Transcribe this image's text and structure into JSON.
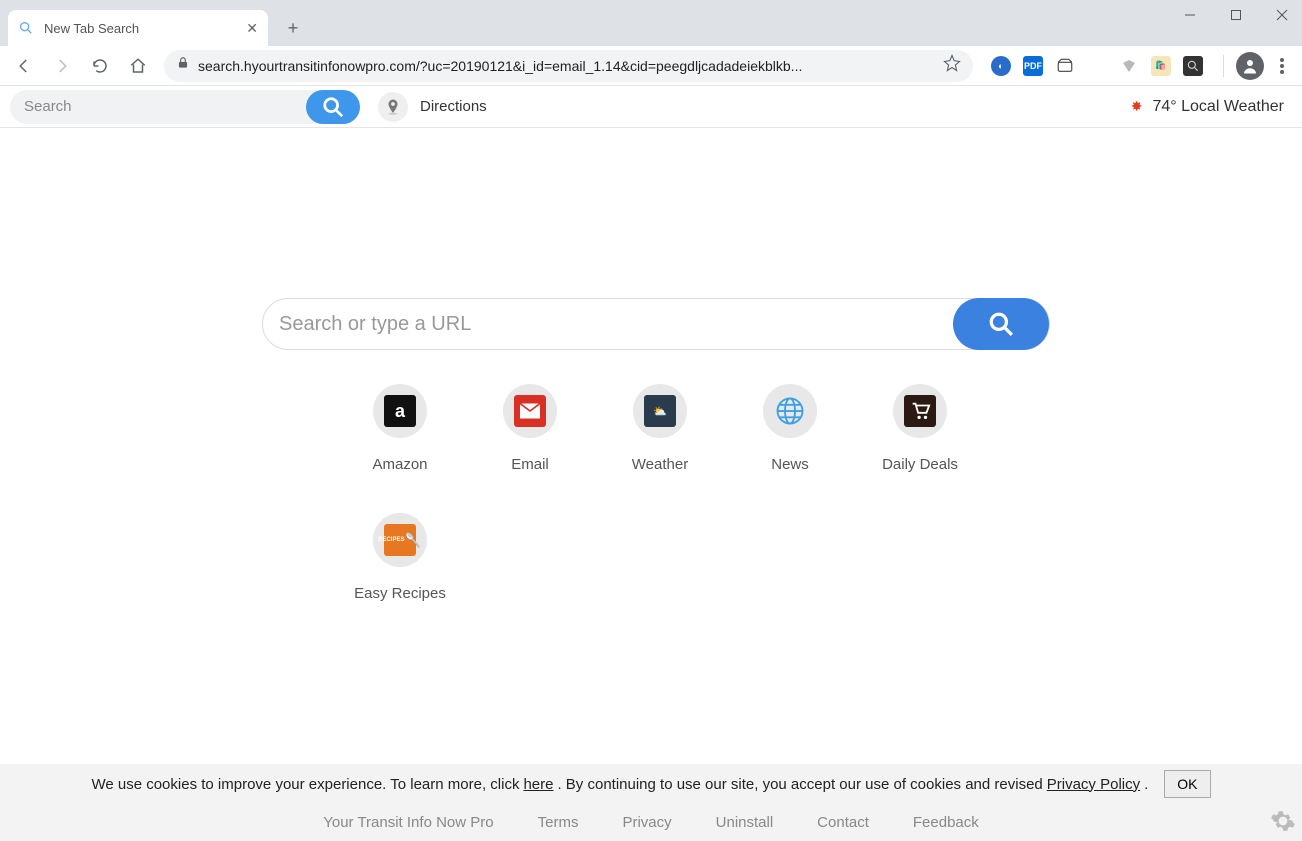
{
  "tab": {
    "title": "New Tab Search"
  },
  "url": "search.hyourtransitinfonowpro.com/?uc=20190121&i_id=email_1.14&cid=peegdljcadadeiekblkb...",
  "page_toolbar": {
    "search_placeholder": "Search",
    "directions_label": "Directions",
    "weather_text": "74° Local Weather"
  },
  "main_search": {
    "placeholder": "Search or type a URL"
  },
  "tiles": [
    {
      "label": "Amazon"
    },
    {
      "label": "Email"
    },
    {
      "label": "Weather"
    },
    {
      "label": "News"
    },
    {
      "label": "Daily Deals"
    },
    {
      "label": "Easy Recipes"
    }
  ],
  "cookie": {
    "pre": "We use cookies to improve your experience. To learn more, click ",
    "here": "here",
    "mid": ". By continuing to use our site, you accept our use of cookies and revised ",
    "policy": "Privacy Policy",
    "post": ".",
    "ok": "OK"
  },
  "footer": {
    "links": [
      "Your Transit Info Now Pro",
      "Terms",
      "Privacy",
      "Uninstall",
      "Contact",
      "Feedback"
    ]
  },
  "ext": {
    "pdf": "PDF"
  }
}
